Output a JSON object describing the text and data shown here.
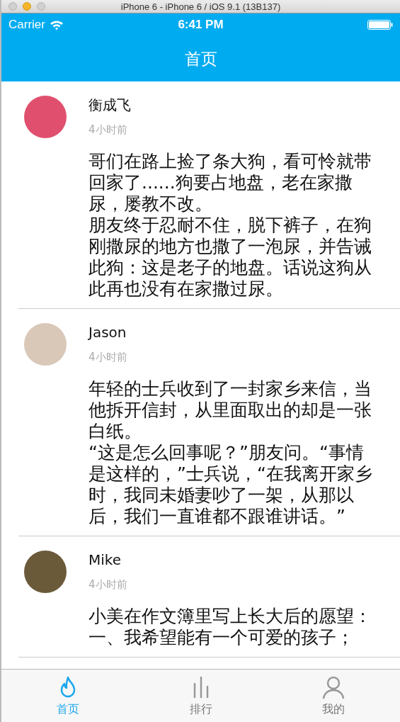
{
  "window": {
    "title": "iPhone 6 - iPhone 6 / iOS 9.1 (13B137)"
  },
  "status_bar": {
    "carrier": "Carrier",
    "time": "6:41 PM"
  },
  "nav_bar": {
    "title": "首页"
  },
  "posts": [
    {
      "name": "衡成飞",
      "time": "4小时前",
      "paragraphs": [
        "哥们在路上捡了条大狗，看可怜就带回家了......狗要占地盘，老在家撒尿，屡教不改。",
        "朋友终于忍耐不住，脱下裤子，在狗刚撒尿的地方也撒了一泡尿，并告诫此狗：这是老子的地盘。话说这狗从此再也没有在家撒过尿。"
      ]
    },
    {
      "name": "Jason",
      "time": "4小时前",
      "paragraphs": [
        "年轻的士兵收到了一封家乡来信，当他拆开信封，从里面取出的却是一张白纸。",
        "“这是怎么回事呢？”朋友问。“事情是这样的，”士兵说，“在我离开家乡时，我同未婚妻吵了一架，从那以后，我们一直谁都不跟谁讲话。”"
      ]
    },
    {
      "name": "Mike",
      "time": "4小时前",
      "paragraphs": [
        "小美在作文簿里写上长大后的愿望：",
        "一、我希望能有一个可爱的孩子；"
      ]
    }
  ],
  "tabs": [
    {
      "label": "首页",
      "kind": "flame",
      "selected": true
    },
    {
      "label": "排行",
      "kind": "bars",
      "selected": false
    },
    {
      "label": "我的",
      "kind": "person",
      "selected": false
    }
  ]
}
